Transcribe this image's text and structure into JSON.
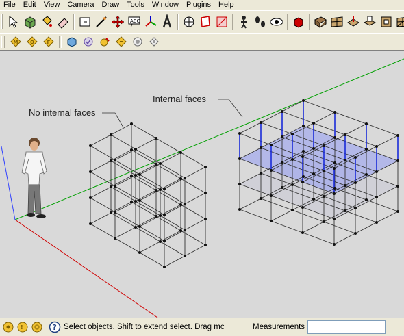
{
  "menu": {
    "items": [
      "File",
      "Edit",
      "View",
      "Camera",
      "Draw",
      "Tools",
      "Window",
      "Plugins",
      "Help"
    ]
  },
  "toolbar_main": {
    "icons": [
      "select-tool",
      "components",
      "paint-bucket",
      "eraser",
      "rectangle-tool",
      "line-tool",
      "circle-tool",
      "arc-tool",
      "polygon-tool",
      "freehand",
      "move-tool",
      "push-pull",
      "rotate",
      "follow-me",
      "scale",
      "offset",
      "tape-measure",
      "dimension",
      "protractor",
      "text",
      "axes",
      "3d-text",
      "orbit",
      "pan",
      "zoom",
      "zoom-window",
      "zoom-extents",
      "previous",
      "next",
      "position-camera",
      "walk",
      "look-around",
      "section-plane"
    ]
  },
  "toolbar_secondary": {
    "icons": [
      "materials-letter-m",
      "outliner-letter-o",
      "fog-letter-f",
      "shadows",
      "styles",
      "layers",
      "scenes",
      "soften-edges",
      "photo-match"
    ]
  },
  "viewport": {
    "callouts": {
      "left": "No internal faces",
      "right": "Internal faces"
    }
  },
  "status": {
    "text": "Select objects. Shift to extend select. Drag mc",
    "measurements_label": "Measurements",
    "measurements_value": ""
  },
  "colors": {
    "viewport_bg": "#d9d9d9",
    "axis_green": "#00a000",
    "axis_red": "#d00000",
    "axis_blue": "#0000ff",
    "internal_face": "#a0a8e8",
    "chrome": "#ece9d8"
  }
}
